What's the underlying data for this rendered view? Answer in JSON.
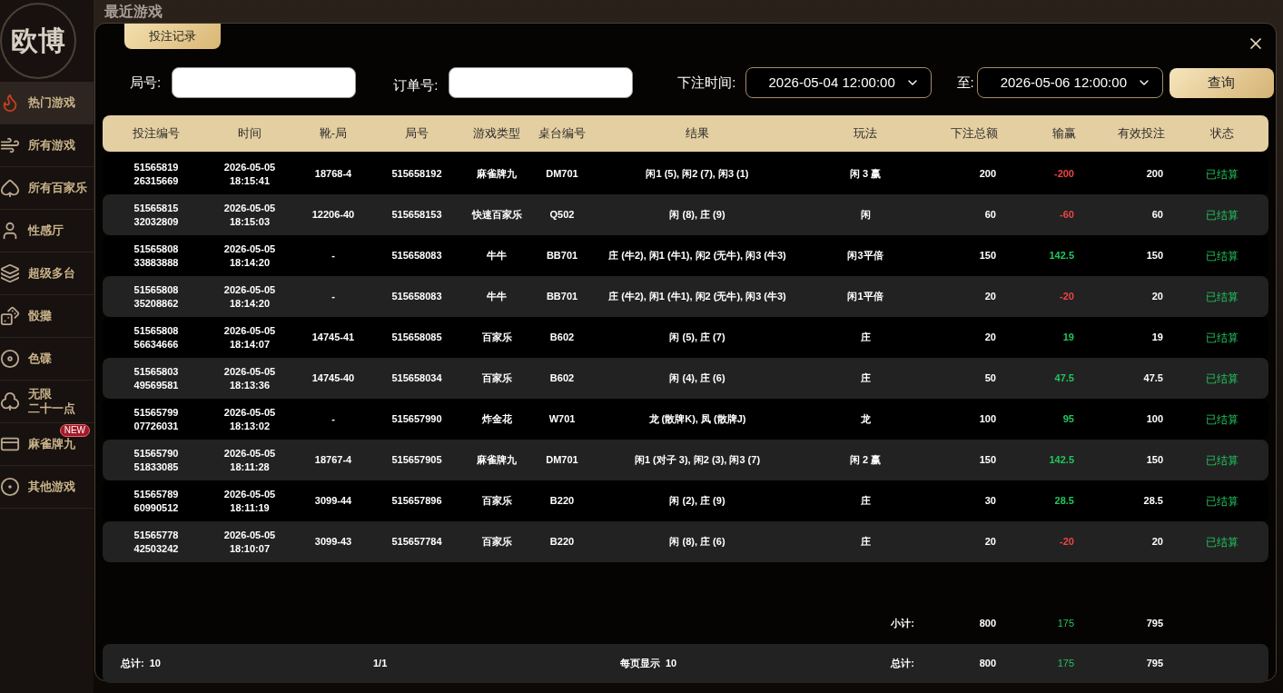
{
  "sidebar": {
    "logo": "欧博",
    "items": [
      {
        "label": "热门游戏",
        "selected": true
      },
      {
        "label": "所有游戏",
        "selected": false
      },
      {
        "label": "所有百家乐",
        "selected": false
      },
      {
        "label": "性感厅",
        "selected": false
      },
      {
        "label": "超级多台",
        "selected": false
      },
      {
        "label": "骰攤",
        "selected": false
      },
      {
        "label": "色碟",
        "selected": false
      },
      {
        "label": "无限",
        "label_2": "二十一点",
        "selected": false
      },
      {
        "label": "麻雀牌九",
        "selected": false,
        "badge": "NEW"
      },
      {
        "label": "其他游戏",
        "selected": false
      }
    ]
  },
  "section_title": "最近游戏",
  "modal": {
    "tab": "投注记录",
    "filters": {
      "round_label": "局号:",
      "order_label": "订单号:",
      "time_label": "下注时间:",
      "start": "2026-05-04 12:00:00",
      "to_label": "至:",
      "end": "2026-05-06 12:00:00",
      "query": "查询"
    },
    "columns": [
      "投注编号",
      "时间",
      "靴-局",
      "局号",
      "游戏类型",
      "桌台编号",
      "结果",
      "玩法",
      "下注总额",
      "输赢",
      "有效投注",
      "状态"
    ],
    "rows": [
      {
        "id": "5156581926315669",
        "time": "2026-05-05 18:15:41",
        "shoe": "18768-4",
        "round": "515658192",
        "game": "麻雀牌九",
        "table": "DM701",
        "result": "闲1 (5), 闲2 (7), 闲3 (1)",
        "play": "闲 3 赢",
        "bet": "200",
        "win": "-200",
        "color": "#ef4444",
        "valid": "200",
        "status": "已结算"
      },
      {
        "id": "5156581532032809",
        "time": "2026-05-05 18:15:03",
        "shoe": "12206-40",
        "round": "515658153",
        "game": "快速百家乐",
        "table": "Q502",
        "result": "闲 (8), 庄 (9)",
        "play": "闲",
        "bet": "60",
        "win": "-60",
        "color": "#ef4444",
        "valid": "60",
        "status": "已结算"
      },
      {
        "id": "5156580833883888",
        "time": "2026-05-05 18:14:20",
        "shoe": "-",
        "round": "515658083",
        "game": "牛牛",
        "table": "BB701",
        "result": "庄 (牛2), 闲1 (牛1), 闲2 (无牛), 闲3 (牛3)",
        "play": "闲3平倍",
        "bet": "150",
        "win": "142.5",
        "color": "#22c55e",
        "valid": "150",
        "status": "已结算"
      },
      {
        "id": "5156580835208862",
        "time": "2026-05-05 18:14:20",
        "shoe": "-",
        "round": "515658083",
        "game": "牛牛",
        "table": "BB701",
        "result": "庄 (牛2), 闲1 (牛1), 闲2 (无牛), 闲3 (牛3)",
        "play": "闲1平倍",
        "bet": "20",
        "win": "-20",
        "color": "#ef4444",
        "valid": "20",
        "status": "已结算"
      },
      {
        "id": "5156580856634666",
        "time": "2026-05-05 18:14:07",
        "shoe": "14745-41",
        "round": "515658085",
        "game": "百家乐",
        "table": "B602",
        "result": "闲 (5), 庄 (7)",
        "play": "庄",
        "bet": "20",
        "win": "19",
        "color": "#22c55e",
        "valid": "19",
        "status": "已结算"
      },
      {
        "id": "5156580349569581",
        "time": "2026-05-05 18:13:36",
        "shoe": "14745-40",
        "round": "515658034",
        "game": "百家乐",
        "table": "B602",
        "result": "闲 (4), 庄 (6)",
        "play": "庄",
        "bet": "50",
        "win": "47.5",
        "color": "#22c55e",
        "valid": "47.5",
        "status": "已结算"
      },
      {
        "id": "5156579907726031",
        "time": "2026-05-05 18:13:02",
        "shoe": "-",
        "round": "515657990",
        "game": "炸金花",
        "table": "W701",
        "result": "龙 (散牌K), 凤 (散牌J)",
        "play": "龙",
        "bet": "100",
        "win": "95",
        "color": "#22c55e",
        "valid": "100",
        "status": "已结算"
      },
      {
        "id": "5156579051833085",
        "time": "2026-05-05 18:11:28",
        "shoe": "18767-4",
        "round": "515657905",
        "game": "麻雀牌九",
        "table": "DM701",
        "result": "闲1 (对子 3), 闲2 (3), 闲3 (7)",
        "play": "闲 2 赢",
        "bet": "150",
        "win": "142.5",
        "color": "#22c55e",
        "valid": "150",
        "status": "已结算"
      },
      {
        "id": "5156578960990512",
        "time": "2026-05-05 18:11:19",
        "shoe": "3099-44",
        "round": "515657896",
        "game": "百家乐",
        "table": "B220",
        "result": "闲 (2), 庄 (9)",
        "play": "庄",
        "bet": "30",
        "win": "28.5",
        "color": "#22c55e",
        "valid": "28.5",
        "status": "已结算"
      },
      {
        "id": "5156577842503242",
        "time": "2026-05-05 18:10:07",
        "shoe": "3099-43",
        "round": "515657784",
        "game": "百家乐",
        "table": "B220",
        "result": "闲 (8), 庄 (6)",
        "play": "庄",
        "bet": "20",
        "win": "-20",
        "color": "#ef4444",
        "valid": "20",
        "status": "已结算"
      }
    ],
    "subtotal": {
      "label": "小计:",
      "bet": "800",
      "win": "175",
      "color": "#22c55e",
      "valid": "795"
    },
    "footer": {
      "count_label": "总计:",
      "count": "10",
      "page": "1/1",
      "per_page_label": "每页显示",
      "per_page": "10",
      "sum_label": "总计:",
      "bet": "800",
      "win": "175",
      "color": "#22c55e",
      "valid": "795"
    }
  }
}
